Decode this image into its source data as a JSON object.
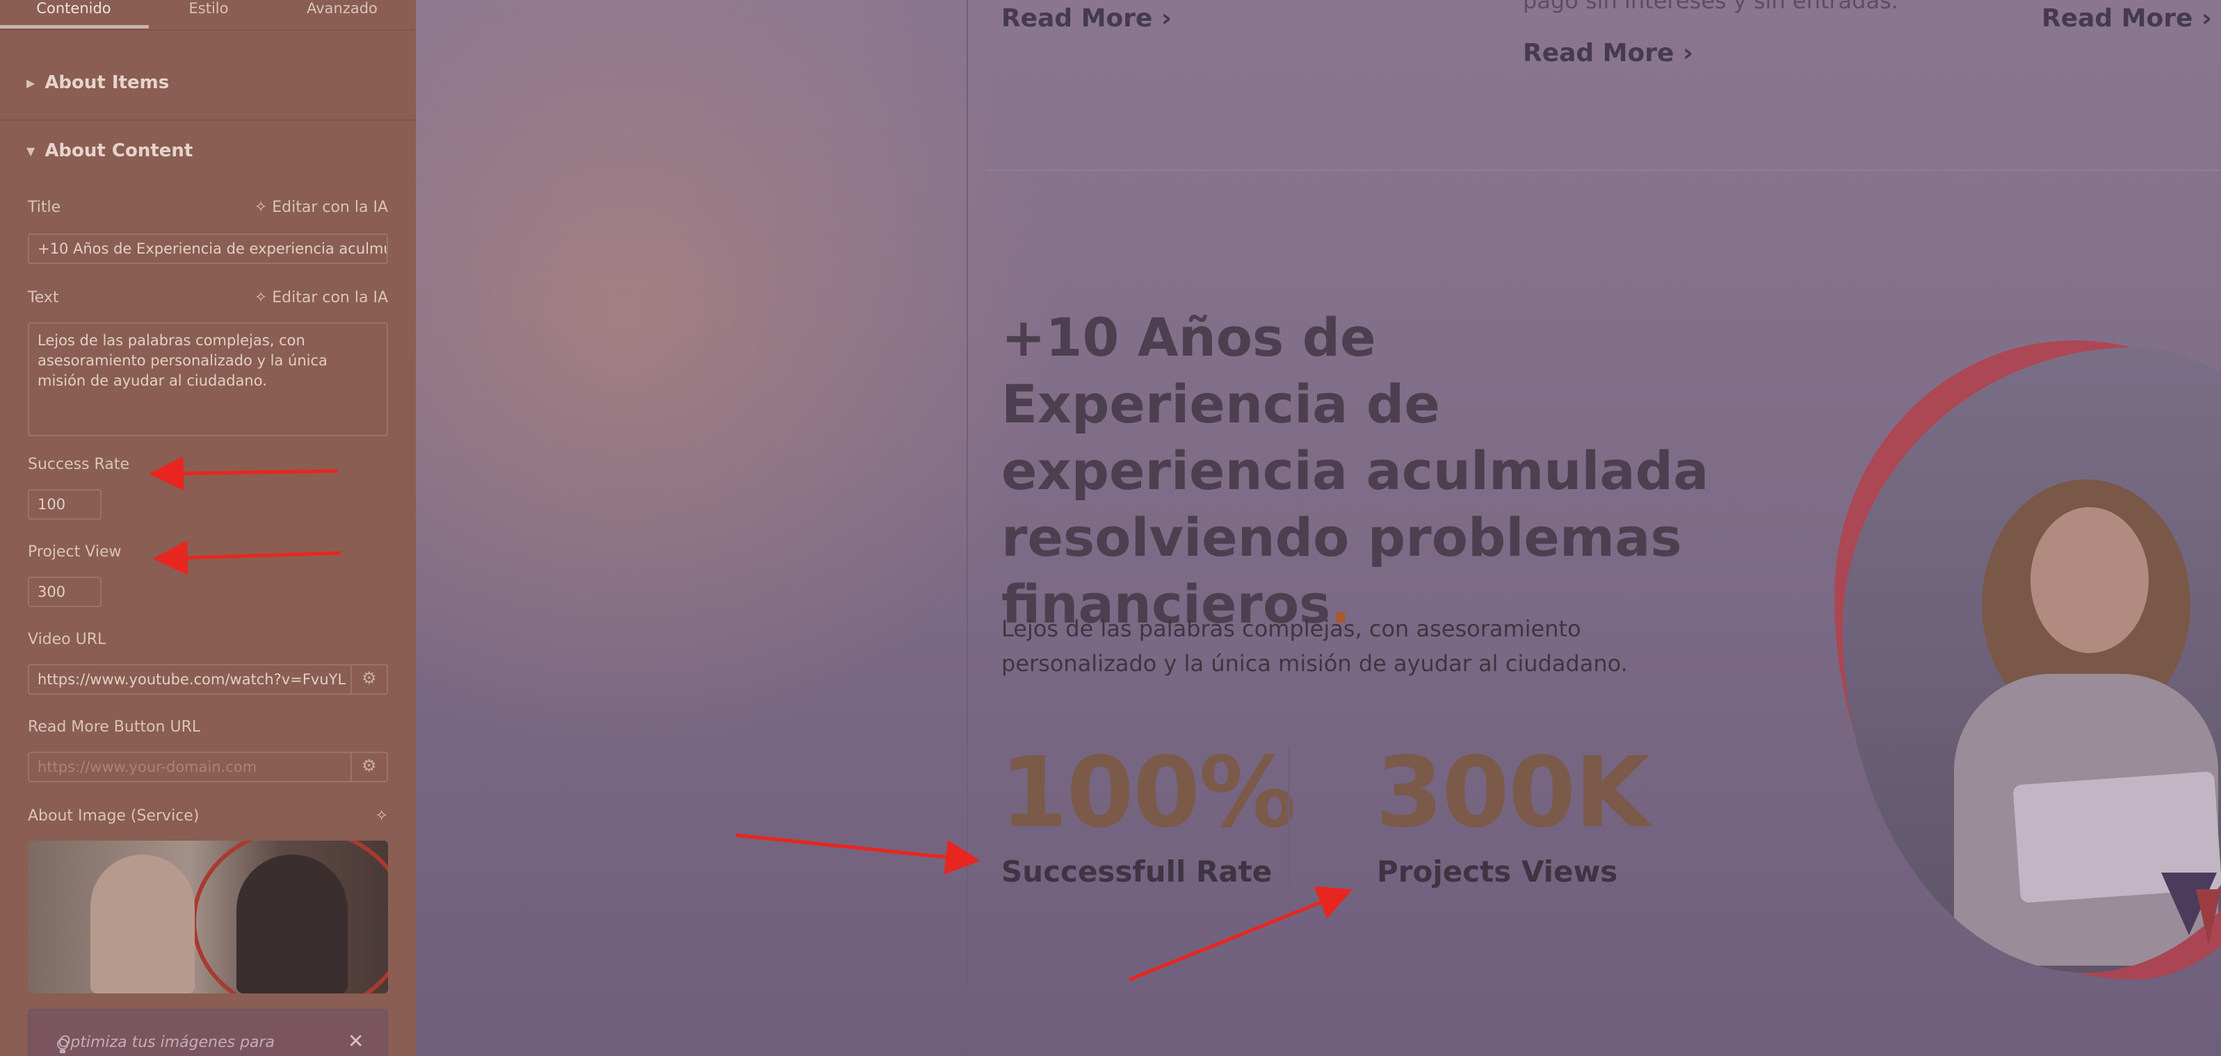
{
  "editor": {
    "tabs": [
      "Contenido",
      "Estilo",
      "Avanzado"
    ],
    "sections": {
      "about_items": "About Items",
      "about_content": "About Content"
    },
    "fields": {
      "title_label": "Title",
      "title_ai": "Editar con la IA",
      "title_value": "+10 Años de Experiencia de experiencia aculmulada resolviendo problemas financieros",
      "text_label": "Text",
      "text_ai": "Editar con la IA",
      "text_value": "Lejos de las palabras complejas, con asesoramiento personalizado y la única misión de ayudar al ciudadano.",
      "success_rate_label": "Success Rate",
      "success_rate_value": "100",
      "project_view_label": "Project View",
      "project_view_value": "300",
      "video_url_label": "Video URL",
      "video_url_value": "https://www.youtube.com/watch?v=FvuYL",
      "read_more_url_label": "Read More Button URL",
      "read_more_url_placeholder": "https://www.your-domain.com",
      "about_image_label": "About Image (Service)"
    },
    "notice_text": "Optimiza tus imágenes para",
    "notice_close": "✕",
    "collapse_glyph": "‹",
    "gear_glyph": "⚙",
    "sparkle_glyph": "✧"
  },
  "preview": {
    "read_more_1": "Read More",
    "read_more_2": "Read More",
    "read_more_3": "Read More",
    "chevron": "›",
    "cut_text": "pago sin intereses y sin entradas.",
    "heading": "+10 Años de Experiencia de experiencia aculmulada resolviendo problemas financieros",
    "heading_dot": ".",
    "description": "Lejos de las palabras complejas, con asesoramiento personalizado y la única misión de ayudar al ciudadano.",
    "stat1_number": "100%",
    "stat1_label": "Successfull Rate",
    "stat2_number": "300K",
    "stat2_label": "Projects Views"
  },
  "colors": {
    "annotation_arrow": "#e8261f",
    "heading_dot": "#a8582e"
  }
}
